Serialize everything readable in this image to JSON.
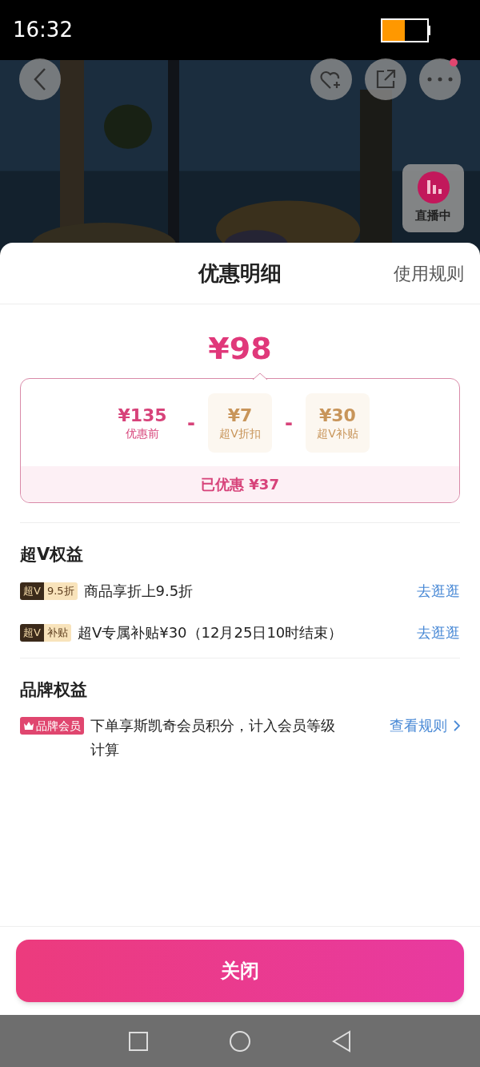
{
  "status_bar": {
    "time": "16:32"
  },
  "live_badge": {
    "label": "直播中"
  },
  "sheet": {
    "title": "优惠明细",
    "rules_link": "使用规则",
    "final_price": "¥98",
    "breakdown": [
      {
        "kind": "original",
        "price": "¥135",
        "label": "优惠前"
      },
      {
        "kind": "discount",
        "operator": "-",
        "price": "¥7",
        "label": "超V折扣"
      },
      {
        "kind": "discount",
        "operator": "-",
        "price": "¥30",
        "label": "超V补贴"
      }
    ],
    "saved": "已优惠 ¥37",
    "sections": [
      {
        "title": "超V权益",
        "items": [
          {
            "kind": "superv",
            "badge": "超V",
            "badge_sub": "9.5折",
            "text": "商品享折上9.5折",
            "action": "去逛逛"
          },
          {
            "kind": "superv",
            "badge": "超V",
            "badge_sub": "补贴",
            "text": "超V专属补贴¥30（12月25日10时结束）",
            "action": "去逛逛"
          }
        ]
      },
      {
        "title": "品牌权益",
        "items": [
          {
            "kind": "brand",
            "badge": "品牌会员",
            "text": "下单享斯凯奇会员积分，计入会员等级计算",
            "action": "查看规则"
          }
        ]
      }
    ],
    "close_button": "关闭"
  }
}
